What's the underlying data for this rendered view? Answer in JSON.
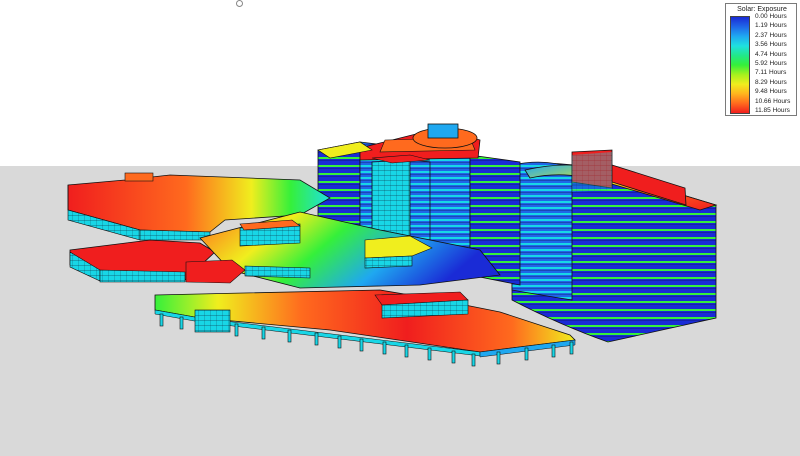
{
  "legend": {
    "title": "Solar: Exposure",
    "items": [
      {
        "label": "0.00 Hours",
        "color": "#1a2bd6"
      },
      {
        "label": "1.19 Hours",
        "color": "#1f66e8"
      },
      {
        "label": "2.37 Hours",
        "color": "#1fa8f0"
      },
      {
        "label": "3.56 Hours",
        "color": "#1fe0e0"
      },
      {
        "label": "4.74 Hours",
        "color": "#22e88a"
      },
      {
        "label": "5.92 Hours",
        "color": "#35f03a"
      },
      {
        "label": "7.11 Hours",
        "color": "#a6f21e"
      },
      {
        "label": "8.29 Hours",
        "color": "#f0ee1e"
      },
      {
        "label": "9.48 Hours",
        "color": "#ffb41e"
      },
      {
        "label": "10.66 Hours",
        "color": "#ff6a1e"
      },
      {
        "label": "11.85 Hours",
        "color": "#f01e1e"
      }
    ]
  },
  "colors": {
    "background": "#ffffff",
    "ground": "#d9d9d9",
    "facade_cyan": "#18d6e6",
    "facade_blue": "#1a2bd6",
    "outline": "#111111"
  },
  "icons": {
    "pivot_marker": "orbit-pivot-icon"
  }
}
